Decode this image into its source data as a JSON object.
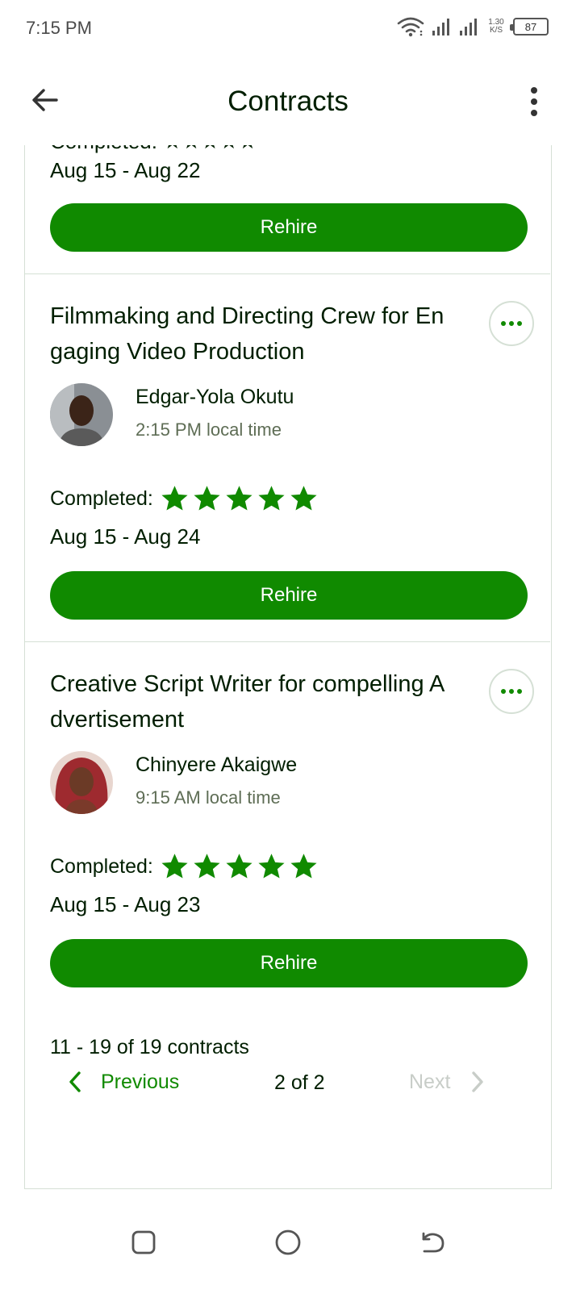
{
  "status_bar": {
    "time": "7:15 PM",
    "net_speed_top": "1.30",
    "net_speed_bottom": "K/S",
    "battery": "87",
    "icons": [
      "wifi-icon",
      "signal-icon",
      "signal-icon",
      "battery-icon"
    ]
  },
  "app_bar": {
    "title": "Contracts",
    "back_icon": "arrow-left-icon",
    "more_icon": "more-vertical-icon"
  },
  "contracts": [
    {
      "clipped": true,
      "clipped_text": "Completed: ★★★★★",
      "dates": "Aug 15 - Aug 22",
      "rehire_label": "Rehire"
    },
    {
      "title": "Filmmaking and Directing Crew for Engaging Video Production",
      "freelancer": "Edgar-Yola Okutu",
      "local_time": "2:15 PM local time",
      "completed_label": "Completed:",
      "rating": 5,
      "dates": "Aug 15 - Aug 24",
      "rehire_label": "Rehire"
    },
    {
      "title": "Creative Script Writer for compelling Advertisement",
      "freelancer": "Chinyere Akaigwe",
      "local_time": "9:15 AM local time",
      "completed_label": "Completed:",
      "rating": 5,
      "dates": "Aug 15 - Aug 23",
      "rehire_label": "Rehire"
    }
  ],
  "pagination": {
    "count_text": "11 - 19 of 19 contracts",
    "previous_label": "Previous",
    "page_indicator": "2 of 2",
    "next_label": "Next"
  },
  "colors": {
    "brand_green": "#108a00",
    "text_dark": "#001e00",
    "muted": "#5e6d55",
    "disabled": "#c8cdc8",
    "border": "#d5e0d5"
  },
  "nav_bar": {
    "icons": [
      "recents-square-icon",
      "home-circle-icon",
      "back-return-icon"
    ]
  }
}
